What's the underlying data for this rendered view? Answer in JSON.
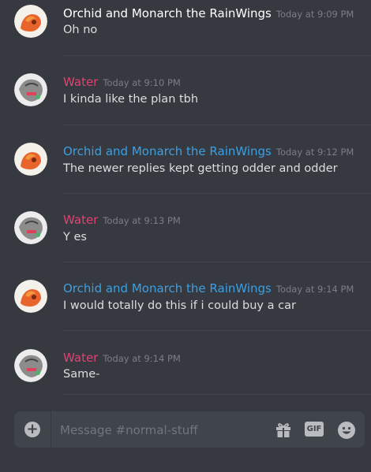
{
  "messages": [
    {
      "author": "Orchid and Monarch the RainWings",
      "timestamp": "Today at 9:09 PM",
      "text": "Oh no",
      "avatar": "orchid-avatar",
      "color": "#ffffff"
    },
    {
      "author": "Water",
      "timestamp": "Today at 9:10 PM",
      "text": "I kinda like the plan tbh",
      "avatar": "water-avatar",
      "color": "#e04273"
    },
    {
      "author": "Orchid and Monarch the RainWings",
      "timestamp": "Today at 9:12 PM",
      "text": "The newer replies kept getting odder and odder",
      "avatar": "orchid-avatar",
      "color": "#3aa0e6"
    },
    {
      "author": "Water",
      "timestamp": "Today at 9:13 PM",
      "text": "Y es",
      "avatar": "water-avatar",
      "color": "#e04273"
    },
    {
      "author": "Orchid and Monarch the RainWings",
      "timestamp": "Today at 9:14 PM",
      "text": "I would totally do this if i could buy a car",
      "avatar": "orchid-avatar",
      "color": "#3aa0e6"
    },
    {
      "author": "Water",
      "timestamp": "Today at 9:14 PM",
      "text": "Same-",
      "avatar": "water-avatar",
      "color": "#e04273"
    }
  ],
  "composer": {
    "placeholder": "Message #normal-stuff",
    "gif_label": "GIF",
    "icons": [
      "plus-icon",
      "gift-icon",
      "gif-icon",
      "emoji-icon"
    ]
  },
  "colors": {
    "background": "#36393f",
    "input_bg": "#40444b",
    "accent_blue": "#3aa0e6",
    "accent_pink": "#e04273"
  }
}
